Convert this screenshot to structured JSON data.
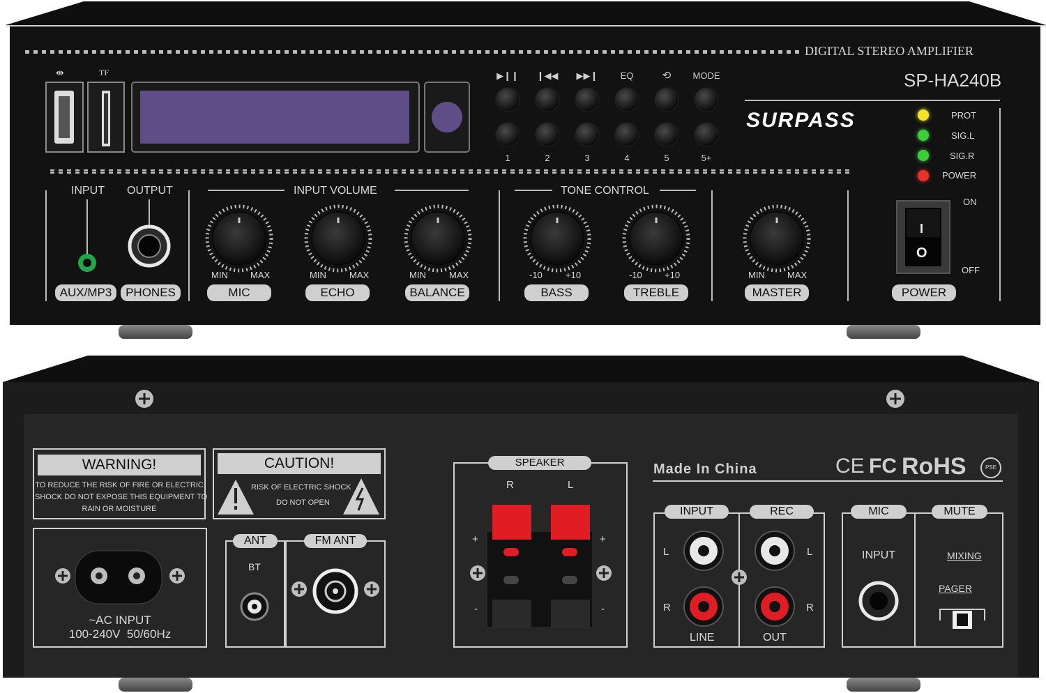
{
  "front": {
    "top_label": "DIGITAL STEREO AMPLIFIER",
    "model": "SP-HA240B",
    "brand": "SURPASS",
    "tf_label": "TF",
    "button_icons": [
      "play-pause-icon",
      "previous-track-icon",
      "next-track-icon",
      "eq",
      "repeat-icon",
      "mode"
    ],
    "eq_label": "EQ",
    "mode_label": "MODE",
    "preset_labels": [
      "1",
      "2",
      "3",
      "4",
      "5",
      "5+"
    ],
    "indicators": [
      {
        "label": "PROT",
        "color": "#f2e22a"
      },
      {
        "label": "SIG.L",
        "color": "#3ecb3e"
      },
      {
        "label": "SIG.R",
        "color": "#3ecb3e"
      },
      {
        "label": "POWER",
        "color": "#e8322a"
      }
    ],
    "input_label": "INPUT",
    "output_label": "OUTPUT",
    "aux_label": "AUX/MP3",
    "phones_label": "PHONES",
    "input_volume_label": "INPUT VOLUME",
    "tone_control_label": "TONE CONTROL",
    "knobs": [
      {
        "name": "MIC",
        "min": "MIN",
        "max": "MAX"
      },
      {
        "name": "ECHO",
        "min": "MIN",
        "max": "MAX"
      },
      {
        "name": "BALANCE",
        "min": "MIN",
        "max": "MAX"
      },
      {
        "name": "BASS",
        "min": "-10",
        "max": "+10"
      },
      {
        "name": "TREBLE",
        "min": "-10",
        "max": "+10"
      },
      {
        "name": "MASTER",
        "min": "MIN",
        "max": "MAX"
      }
    ],
    "switch_on": "ON",
    "switch_off": "OFF",
    "power_label": "POWER",
    "switch_i": "I",
    "switch_o": "O"
  },
  "rear": {
    "warning_title": "WARNING!",
    "warning_lines": [
      "TO REDUCE THE RISK OF FIRE OR ELECTRIC",
      "SHOCK DO NOT EXPOSE THIS EQUIPMENT TO",
      "RAIN OR MOISTURE"
    ],
    "caution_title": "CAUTION!",
    "caution_lines": [
      "RISK OF ELECTRIC SHOCK",
      "DO NOT OPEN"
    ],
    "ac_input_label": "~AC INPUT",
    "ac_voltage": "100-240V  50/60Hz",
    "ant_label": "ANT",
    "bt_label": "BT",
    "fm_ant_label": "FM ANT",
    "speaker_label": "SPEAKER",
    "speaker_r": "R",
    "speaker_l": "L",
    "plus": "+",
    "minus": "-",
    "made_in": "Made In China",
    "cert_ce": "CE",
    "cert_fc": "FC",
    "cert_rohs": "RoHS",
    "cert_pse": "PSE",
    "input_label": "INPUT",
    "rec_label": "REC",
    "line_label": "LINE",
    "out_label": "OUT",
    "l_label": "L",
    "r_label": "R",
    "mic_label": "MIC",
    "mic_input_label": "INPUT",
    "mute_label": "MUTE",
    "mixing_label": "MIXING",
    "pager_label": "PAGER"
  }
}
